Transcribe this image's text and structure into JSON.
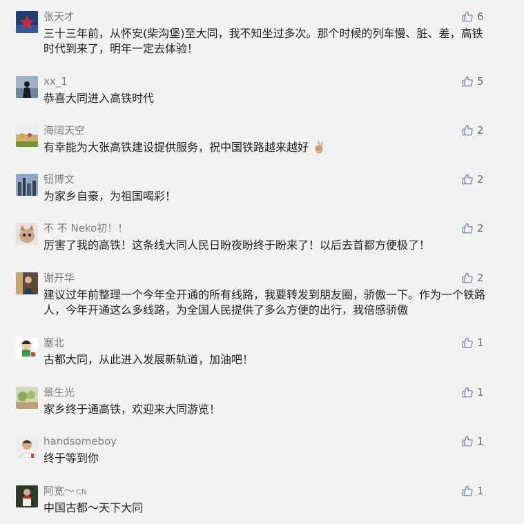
{
  "comments": [
    {
      "name": "张天才",
      "text": "三十三年前，从怀安(柴沟堡)至大同，我不知坐过多次。那个时候的列车慢、脏、差，高铁时代到来了，明年一定去体验！",
      "likes": "6",
      "avatar": "red-star-avatar"
    },
    {
      "name": "xx_1",
      "text": "恭喜大同进入高铁时代",
      "likes": "5",
      "avatar": "person-silhouette-avatar"
    },
    {
      "name": "海阔天空",
      "text": "有幸能为大张高铁建设提供服务，祝中国铁路越来越好",
      "emoji": "✌🏼",
      "likes": "2",
      "avatar": "field-landscape-avatar"
    },
    {
      "name": "钮博文",
      "text": "为家乡自豪，为祖国喝彩！",
      "likes": "2",
      "avatar": "city-skyline-avatar"
    },
    {
      "name": "不 不 Neko初！！",
      "text": "厉害了我的高铁！这条线大同人民日盼夜盼终于盼来了！以后去首都方便极了！",
      "likes": "2",
      "avatar": "cat-avatar"
    },
    {
      "name": "谢开华",
      "text": "建议过年前整理一个今年全开通的所有线路，我要转发到朋友圈，骄傲一下。作为一个铁路人，今年开通这么多线路，为全国人民提供了多么方便的出行，我倍感骄傲",
      "likes": "2",
      "avatar": "person-photo-avatar"
    },
    {
      "name": "塞北",
      "text": "古都大同，从此进入发展新轨道，加油吧！",
      "likes": "1",
      "avatar": "cartoon-avatar"
    },
    {
      "name": "景生光",
      "text": "家乡终于通高铁，欢迎来大同游览！",
      "likes": "1",
      "avatar": "garden-avatar"
    },
    {
      "name": "handsomeboy",
      "text": "终于等到你",
      "likes": "1",
      "avatar": "man-portrait-avatar"
    },
    {
      "name": "阿宽～",
      "name_suffix": "CN",
      "text": "中国古都～天下大同",
      "likes": "1",
      "avatar": "soccer-player-avatar"
    }
  ],
  "colors": {
    "name": "#7d7d7d",
    "text": "#222222",
    "like": "#6b6b6b",
    "background": "#f2f2f2"
  }
}
